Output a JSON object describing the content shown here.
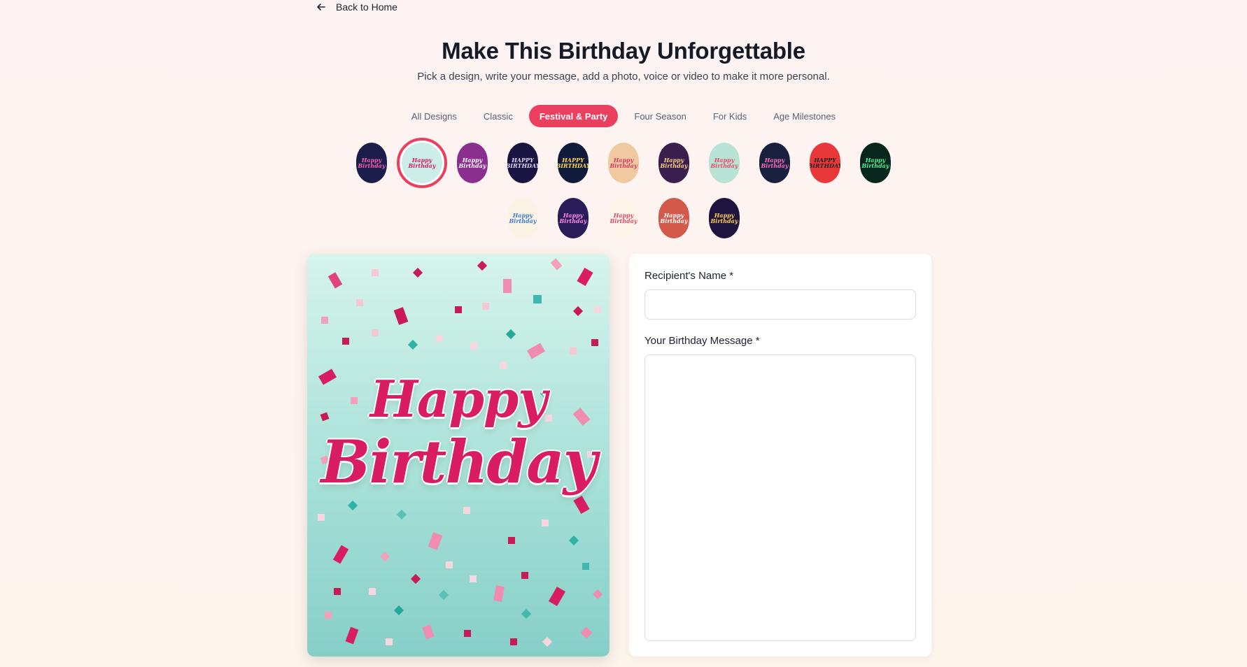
{
  "nav": {
    "back_label": "Back to Home"
  },
  "header": {
    "title": "Make This Birthday Unforgettable",
    "subtitle": "Pick a design, write your message, add a photo, voice or video to make it more personal."
  },
  "tabs": [
    {
      "label": "All Designs",
      "active": false
    },
    {
      "label": "Classic",
      "active": false
    },
    {
      "label": "Festival & Party",
      "active": true
    },
    {
      "label": "Four Season",
      "active": false
    },
    {
      "label": "For Kids",
      "active": false
    },
    {
      "label": "Age Milestones",
      "active": false
    }
  ],
  "designs_row1": [
    {
      "bg": "#1b1d4a",
      "fg": "#ff5ab3",
      "text": "Happy Birthday",
      "selected": false
    },
    {
      "bg": "#cdeee8",
      "fg": "#d81d62",
      "text": "Happy Birthday",
      "selected": true
    },
    {
      "bg": "#8b2f8f",
      "fg": "#ffffff",
      "text": "Happy Birthday",
      "selected": false
    },
    {
      "bg": "#1a1440",
      "fg": "#d8d8ff",
      "text": "HAPPY BIRTHDAY",
      "selected": false
    },
    {
      "bg": "#101a3a",
      "fg": "#ffd84a",
      "text": "HAPPY BIRTHDAY",
      "selected": false
    },
    {
      "bg": "#f1c9a0",
      "fg": "#d43a6a",
      "text": "Happy Birthday",
      "selected": false
    },
    {
      "bg": "#3a1e4e",
      "fg": "#ffd27a",
      "text": "Happy Birthday",
      "selected": false
    },
    {
      "bg": "#b9e3d6",
      "fg": "#e84a6a",
      "text": "Happy Birthday",
      "selected": false
    },
    {
      "bg": "#1a2040",
      "fg": "#ff6ac0",
      "text": "Happy Birthday",
      "selected": false
    },
    {
      "bg": "#e8383a",
      "fg": "#222222",
      "text": "HAPPY BIRTHDAY",
      "selected": false
    },
    {
      "bg": "#06261e",
      "fg": "#4cf590",
      "text": "Happy Birthday",
      "selected": false
    }
  ],
  "designs_row2": [
    {
      "bg": "#fbf3e4",
      "fg": "#3d7ad8",
      "text": "Happy Birthday",
      "selected": false
    },
    {
      "bg": "#2a1b5a",
      "fg": "#ff8ae0",
      "text": "Happy Birthday",
      "selected": false
    },
    {
      "bg": "#fdf4ea",
      "fg": "#e2486a",
      "text": "Happy Birthday",
      "selected": false
    },
    {
      "bg": "#d35a4a",
      "fg": "#ffffff",
      "text": "Happy Birthday",
      "selected": false
    },
    {
      "bg": "#1f1440",
      "fg": "#ffcf4a",
      "text": "Happy Birthday",
      "selected": false
    }
  ],
  "card": {
    "line1": "Happy",
    "line2": "Birthday"
  },
  "form": {
    "name_label": "Recipient's Name *",
    "name_value": "",
    "message_label": "Your Birthday Message *",
    "message_value": ""
  },
  "colors": {
    "accent": "#ea3f5f",
    "card_text": "#d81d62"
  }
}
